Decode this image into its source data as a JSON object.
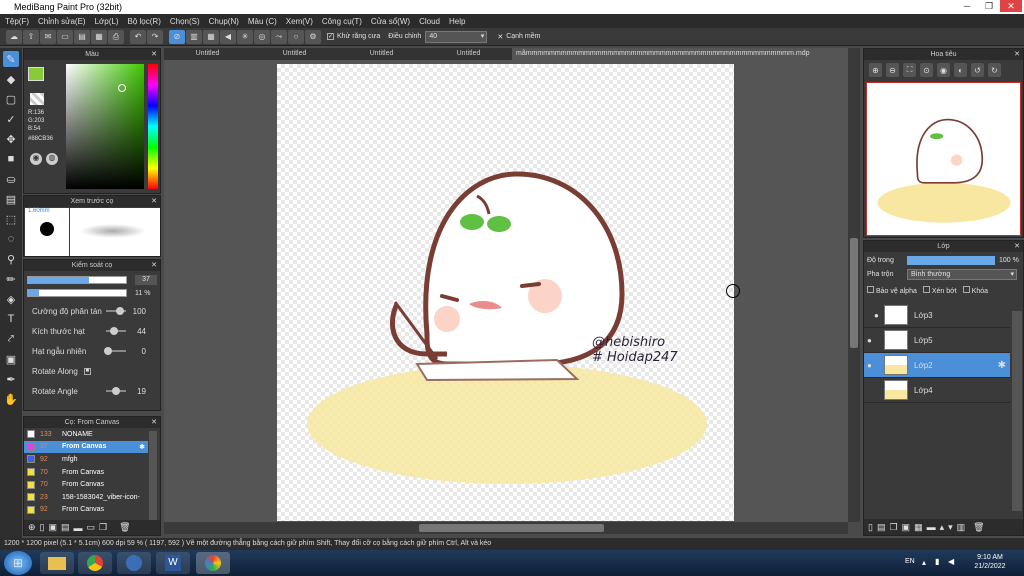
{
  "titlebar": {
    "title": "MediBang Paint Pro (32bit)"
  },
  "menu": [
    "Tệp(F)",
    "Chỉnh sửa(E)",
    "Lớp(L)",
    "Bộ lọc(R)",
    "Chọn(S)",
    "Chụp(N)",
    "Màu (C)",
    "Xem(V)",
    "Công cụ(T)",
    "Cửa sổ(W)",
    "Cloud",
    "Help"
  ],
  "toolbar": {
    "antialias_label": "Khử răng cưa",
    "adjust_label": "Điều chỉnh",
    "adjust_value": "40",
    "edge_label": "Cạnh mềm"
  },
  "tabs": [
    "Untitled",
    "Untitled",
    "Untitled",
    "Untitled",
    "mãmmmmmmmmmmmmmmmmmmmmmmmmmmmmmmmmmmmmmmmmmmmmmm.mdp"
  ],
  "color_panel": {
    "title": "Màu",
    "r": "R:136",
    "g": "G:203",
    "b": "B:54",
    "hex": "#88CB36",
    "primary_color": "#88CB36"
  },
  "brush_preview": {
    "title": "Xem trước cọ",
    "size": "1.60mm"
  },
  "brush_control": {
    "title": "Kiểm soát cọ",
    "size_value": "37",
    "opacity_value": "11 %",
    "params": [
      {
        "label": "Cường độ phân tán",
        "value": "100"
      },
      {
        "label": "Kích thước hạt",
        "value": "44"
      },
      {
        "label": "Hạt ngẫu nhiên",
        "value": "0"
      },
      {
        "label": "Rotate Along",
        "value": ""
      },
      {
        "label": "Rotate Angle",
        "value": "19"
      }
    ]
  },
  "brush_list": {
    "title": "Cọ: From Canvas",
    "items": [
      {
        "num": "133",
        "name": "NONAME",
        "color": "#ffffff"
      },
      {
        "num": "37",
        "name": "From Canvas",
        "color": "#e040e0"
      },
      {
        "num": "92",
        "name": "mfgh",
        "color": "#4060e0"
      },
      {
        "num": "70",
        "name": "From Canvas",
        "color": "#f0e040"
      },
      {
        "num": "70",
        "name": "From Canvas",
        "color": "#f0e040"
      },
      {
        "num": "23",
        "name": "158-1583042_viber-icon-",
        "color": "#f0e040"
      },
      {
        "num": "92",
        "name": "From Canvas",
        "color": "#f0e040"
      }
    ]
  },
  "navigator": {
    "title": "Hoa tiêu"
  },
  "layers": {
    "title": "Lớp",
    "opacity_label": "Độ trong",
    "opacity_value": "100 %",
    "blend_label": "Pha trộn",
    "blend_value": "Bình thường",
    "protect_alpha": "Bảo vệ alpha",
    "clipping": "Xén bớt",
    "lock": "Khóa",
    "items": [
      {
        "name": "Lớp3",
        "selected": false
      },
      {
        "name": "Lớp5",
        "selected": false
      },
      {
        "name": "Lớp2",
        "selected": true
      },
      {
        "name": "Lớp4",
        "selected": false
      }
    ]
  },
  "canvas_text": {
    "line1": "@hebishiro",
    "line2": "# Hoidap247"
  },
  "status": {
    "text": "1200 * 1200 pixel  (5.1 * 5.1cm)  600 dpi  59 %  ( 1197, 592 )  Vẽ một đường thẳng bằng cách giữ phím Shift, Thay đổi cỡ cọ bằng cách giữ phím Ctrl, Alt và kéo"
  },
  "taskbar": {
    "lang": "EN",
    "time": "9:10 AM",
    "date": "21/2/2022"
  }
}
